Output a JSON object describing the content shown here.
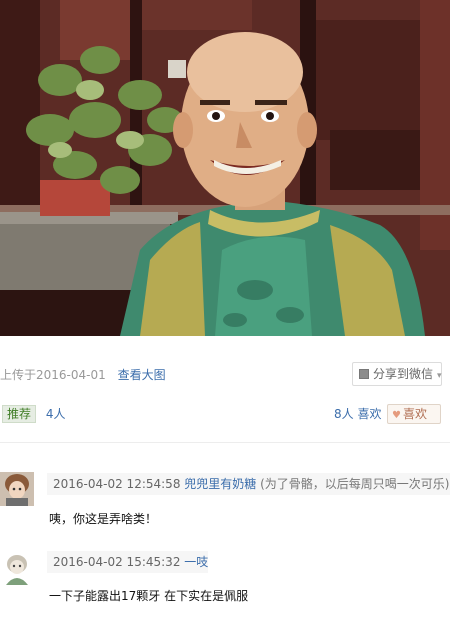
{
  "photo": {
    "alt": ""
  },
  "meta": {
    "upload": "上传于2016-04-01",
    "view_large": "查看大图",
    "share": "分享到微信",
    "share_icon": "wechat-icon"
  },
  "rec": {
    "label": "推荐",
    "count": "4人"
  },
  "like": {
    "count": "8人 喜欢",
    "label": "喜欢",
    "icon": "heart-icon"
  },
  "comments": [
    {
      "time": "2016-04-02 12:54:58",
      "user": "兜兜里有奶糖",
      "signature": "(为了骨骼，以后每周只喝一次可乐)",
      "text": "咦，你这是弄啥类！"
    },
    {
      "time": "2016-04-02 15:45:32",
      "user": "一吱",
      "signature": "",
      "text": "一下子能露出17颗牙 在下实在是佩服"
    }
  ],
  "colors": {
    "link": "#3b6dab",
    "rec_green": "#3f7d25",
    "like_brown": "#b06e52"
  }
}
